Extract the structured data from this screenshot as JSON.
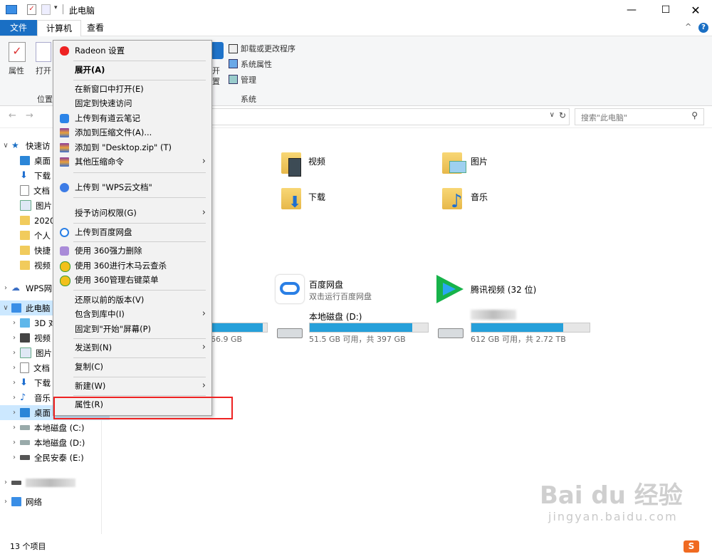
{
  "window": {
    "title": "此电脑"
  },
  "tabs": [
    {
      "label": "文件"
    },
    {
      "label": "计算机"
    },
    {
      "label": "查看"
    }
  ],
  "ribbon": {
    "properties": "属性",
    "open": "打开",
    "location_group": "位置",
    "open2": "开",
    "settings": "置",
    "system_group": "系统",
    "uninstall": "卸载或更改程序",
    "sys_props": "系统属性",
    "manage": "管理"
  },
  "search": {
    "placeholder": "搜索\"此电脑\""
  },
  "nav": {
    "quick_access": "快速访",
    "items": [
      {
        "label": "桌面"
      },
      {
        "label": "下载"
      },
      {
        "label": "文档"
      },
      {
        "label": "图片"
      },
      {
        "label": "2020"
      },
      {
        "label": "个人"
      },
      {
        "label": "快捷"
      },
      {
        "label": "视频"
      }
    ],
    "wps": "WPS网",
    "this_pc": "此电脑",
    "pc_items": [
      {
        "label": "3D 对"
      },
      {
        "label": "视频"
      },
      {
        "label": "图片"
      },
      {
        "label": "文档"
      },
      {
        "label": "下载"
      },
      {
        "label": "音乐"
      },
      {
        "label": "桌面"
      },
      {
        "label": "本地磁盘 (C:)"
      },
      {
        "label": "本地磁盘 (D:)"
      },
      {
        "label": "全民安泰 (E:)"
      }
    ],
    "network": "网络"
  },
  "content": {
    "folders": [
      {
        "label": "视频"
      },
      {
        "label": "图片"
      },
      {
        "label": "下载"
      },
      {
        "label": "音乐"
      }
    ],
    "baidu": {
      "title": "百度网盘",
      "subtitle": "双击运行百度网盘"
    },
    "tencent": {
      "title": "腾讯视频 (32 位)"
    },
    "drive_c": {
      "free": "66.9 GB",
      "fill": 0.92
    },
    "drive_d": {
      "title": "本地磁盘 (D:)",
      "free": "51.5 GB 可用，共 397 GB",
      "fill": 0.87
    },
    "drive_e": {
      "free": "612 GB 可用，共 2.72 TB",
      "fill": 0.78
    }
  },
  "menu": {
    "items": [
      {
        "label": "Radeon 设置"
      },
      {
        "label": "展开(A)"
      },
      {
        "label": "在新窗口中打开(E)"
      },
      {
        "label": "固定到快速访问"
      },
      {
        "label": "上传到有道云笔记"
      },
      {
        "label": "添加到压缩文件(A)..."
      },
      {
        "label": "添加到 \"Desktop.zip\" (T)"
      },
      {
        "label": "其他压缩命令"
      },
      {
        "label": "上传到 \"WPS云文档\""
      },
      {
        "label": "授予访问权限(G)"
      },
      {
        "label": "上传到百度网盘"
      },
      {
        "label": "使用 360强力删除"
      },
      {
        "label": "使用 360进行木马云查杀"
      },
      {
        "label": "使用 360管理右键菜单"
      },
      {
        "label": "还原以前的版本(V)"
      },
      {
        "label": "包含到库中(I)"
      },
      {
        "label": "固定到\"开始\"屏幕(P)"
      },
      {
        "label": "发送到(N)"
      },
      {
        "label": "复制(C)"
      },
      {
        "label": "新建(W)"
      },
      {
        "label": "属性(R)"
      }
    ]
  },
  "status": {
    "count": "13 个项目"
  },
  "watermark": {
    "text": "Bai du 经验",
    "url": "jingyan.baidu.com"
  },
  "colors": {
    "accent": "#1a6fc4",
    "selection": "#cce8ff",
    "highlight_box": "#e22222",
    "drive_fill": "#26a0da"
  }
}
